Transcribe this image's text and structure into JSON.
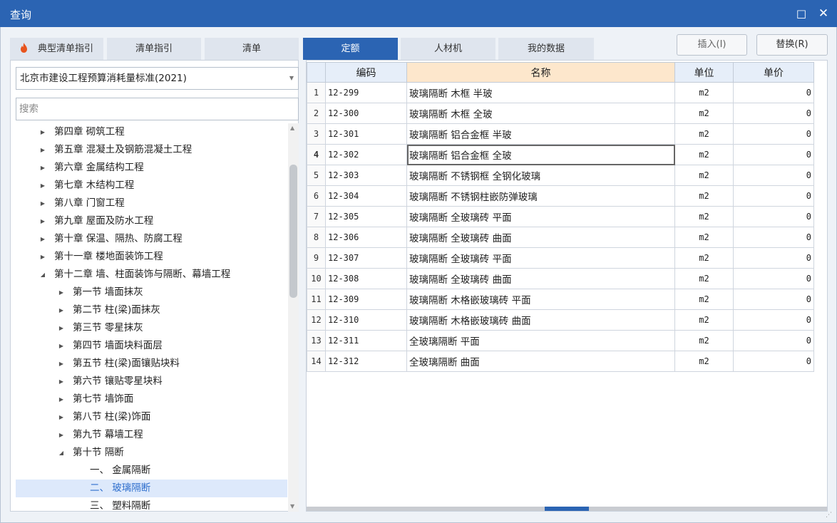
{
  "window": {
    "title": "查询",
    "maximize_glyph": "□",
    "close_glyph": "✕"
  },
  "tabs": [
    {
      "label": "典型清单指引",
      "icon": "flame-icon"
    },
    {
      "label": "清单指引"
    },
    {
      "label": "清单"
    },
    {
      "label": "定额",
      "active": true
    },
    {
      "label": "人材机"
    },
    {
      "label": "我的数据"
    }
  ],
  "actions": {
    "insert_label": "插入(I)",
    "replace_label": "替换(R)"
  },
  "library": {
    "selected": "北京市建设工程预算消耗量标准(2021)"
  },
  "search": {
    "placeholder": "搜索"
  },
  "tree": [
    {
      "label": "第四章 砌筑工程",
      "level": 1,
      "expanded": false
    },
    {
      "label": "第五章 混凝土及钢筋混凝土工程",
      "level": 1,
      "expanded": false
    },
    {
      "label": "第六章 金属结构工程",
      "level": 1,
      "expanded": false
    },
    {
      "label": "第七章 木结构工程",
      "level": 1,
      "expanded": false
    },
    {
      "label": "第八章 门窗工程",
      "level": 1,
      "expanded": false
    },
    {
      "label": "第九章 屋面及防水工程",
      "level": 1,
      "expanded": false
    },
    {
      "label": "第十章 保温、隔热、防腐工程",
      "level": 1,
      "expanded": false
    },
    {
      "label": "第十一章 楼地面装饰工程",
      "level": 1,
      "expanded": false
    },
    {
      "label": "第十二章 墙、柱面装饰与隔断、幕墙工程",
      "level": 1,
      "expanded": true
    },
    {
      "label": "第一节 墙面抹灰",
      "level": 2,
      "expanded": false
    },
    {
      "label": "第二节 柱(梁)面抹灰",
      "level": 2,
      "expanded": false
    },
    {
      "label": "第三节 零星抹灰",
      "level": 2,
      "expanded": false
    },
    {
      "label": "第四节 墙面块料面层",
      "level": 2,
      "expanded": false
    },
    {
      "label": "第五节 柱(梁)面镶贴块料",
      "level": 2,
      "expanded": false
    },
    {
      "label": "第六节 镶贴零星块料",
      "level": 2,
      "expanded": false
    },
    {
      "label": "第七节 墙饰面",
      "level": 2,
      "expanded": false
    },
    {
      "label": "第八节 柱(梁)饰面",
      "level": 2,
      "expanded": false
    },
    {
      "label": "第九节 幕墙工程",
      "level": 2,
      "expanded": false
    },
    {
      "label": "第十节 隔断",
      "level": 2,
      "expanded": true
    },
    {
      "label": "一、 金属隔断",
      "level": 3
    },
    {
      "label": "二、 玻璃隔断",
      "level": 3,
      "selected": true
    },
    {
      "label": "三、 塑料隔断",
      "level": 3
    }
  ],
  "table": {
    "columns": [
      "编码",
      "名称",
      "单位",
      "单价"
    ],
    "current_row": 4,
    "rows": [
      {
        "num": "1",
        "code": "12-299",
        "name": "玻璃隔断 木框 半玻",
        "unit": "m2",
        "price": "0"
      },
      {
        "num": "2",
        "code": "12-300",
        "name": "玻璃隔断 木框 全玻",
        "unit": "m2",
        "price": "0"
      },
      {
        "num": "3",
        "code": "12-301",
        "name": "玻璃隔断 铝合金框 半玻",
        "unit": "m2",
        "price": "0"
      },
      {
        "num": "4",
        "code": "12-302",
        "name": "玻璃隔断 铝合金框 全玻",
        "unit": "m2",
        "price": "0"
      },
      {
        "num": "5",
        "code": "12-303",
        "name": "玻璃隔断 不锈钢框 全钢化玻璃",
        "unit": "m2",
        "price": "0"
      },
      {
        "num": "6",
        "code": "12-304",
        "name": "玻璃隔断 不锈钢柱嵌防弹玻璃",
        "unit": "m2",
        "price": "0"
      },
      {
        "num": "7",
        "code": "12-305",
        "name": "玻璃隔断 全玻璃砖 平面",
        "unit": "m2",
        "price": "0"
      },
      {
        "num": "8",
        "code": "12-306",
        "name": "玻璃隔断 全玻璃砖 曲面",
        "unit": "m2",
        "price": "0"
      },
      {
        "num": "9",
        "code": "12-307",
        "name": "玻璃隔断 全玻璃砖 平面",
        "unit": "m2",
        "price": "0"
      },
      {
        "num": "10",
        "code": "12-308",
        "name": "玻璃隔断 全玻璃砖 曲面",
        "unit": "m2",
        "price": "0"
      },
      {
        "num": "11",
        "code": "12-309",
        "name": "玻璃隔断 木格嵌玻璃砖 平面",
        "unit": "m2",
        "price": "0"
      },
      {
        "num": "12",
        "code": "12-310",
        "name": "玻璃隔断 木格嵌玻璃砖 曲面",
        "unit": "m2",
        "price": "0"
      },
      {
        "num": "13",
        "code": "12-311",
        "name": "全玻璃隔断 平面",
        "unit": "m2",
        "price": "0"
      },
      {
        "num": "14",
        "code": "12-312",
        "name": "全玻璃隔断 曲面",
        "unit": "m2",
        "price": "0"
      }
    ]
  },
  "colors": {
    "accent": "#2b64b3",
    "header_highlight": "#fde7cc",
    "selected_node": "#dde9fb"
  }
}
